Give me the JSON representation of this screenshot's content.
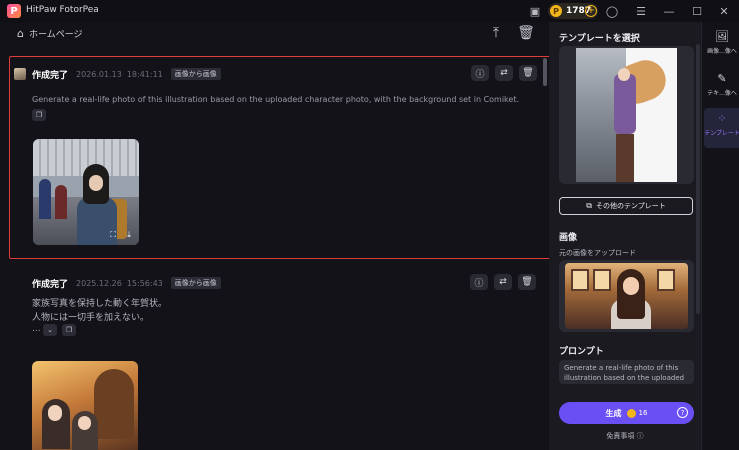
{
  "app": {
    "title": "HitPaw FotorPea",
    "logo_letter": "P",
    "credits": "1787"
  },
  "toolbar": {
    "home_label": "ホームページ"
  },
  "history": [
    {
      "title": "作成完了",
      "date": "2026.01.13",
      "time": "18:41:11",
      "tag": "画像から画像",
      "prompt": "Generate a real-life photo of this illustration based on the uploaded character photo, with the background set in Comiket."
    },
    {
      "title": "作成完了",
      "date": "2025.12.26",
      "time": "15:56:43",
      "tag": "画像から画像",
      "prompt_lines": [
        "家族写真を保持した動く年賀状。",
        "人物には一切手を加えない。"
      ],
      "ellipsis": "..."
    }
  ],
  "right_panel": {
    "template_section": "テンプレートを選択",
    "more_templates": "その他のテンプレート",
    "image_section": "画像",
    "upload_label": "元の画像をアップロード",
    "prompt_section": "プロンプト",
    "prompt_preview": "Generate a real-life photo of this illustration based on the uploaded",
    "generate_label": "生成",
    "generate_cost": "16",
    "disclaimer": "免責事項"
  },
  "side_nav": [
    {
      "label": "画像...像へ",
      "icon": "image-icon"
    },
    {
      "label": "テキ...像へ",
      "icon": "text-image-icon"
    },
    {
      "label": "テンプレート",
      "icon": "template-icon",
      "active": true
    }
  ]
}
